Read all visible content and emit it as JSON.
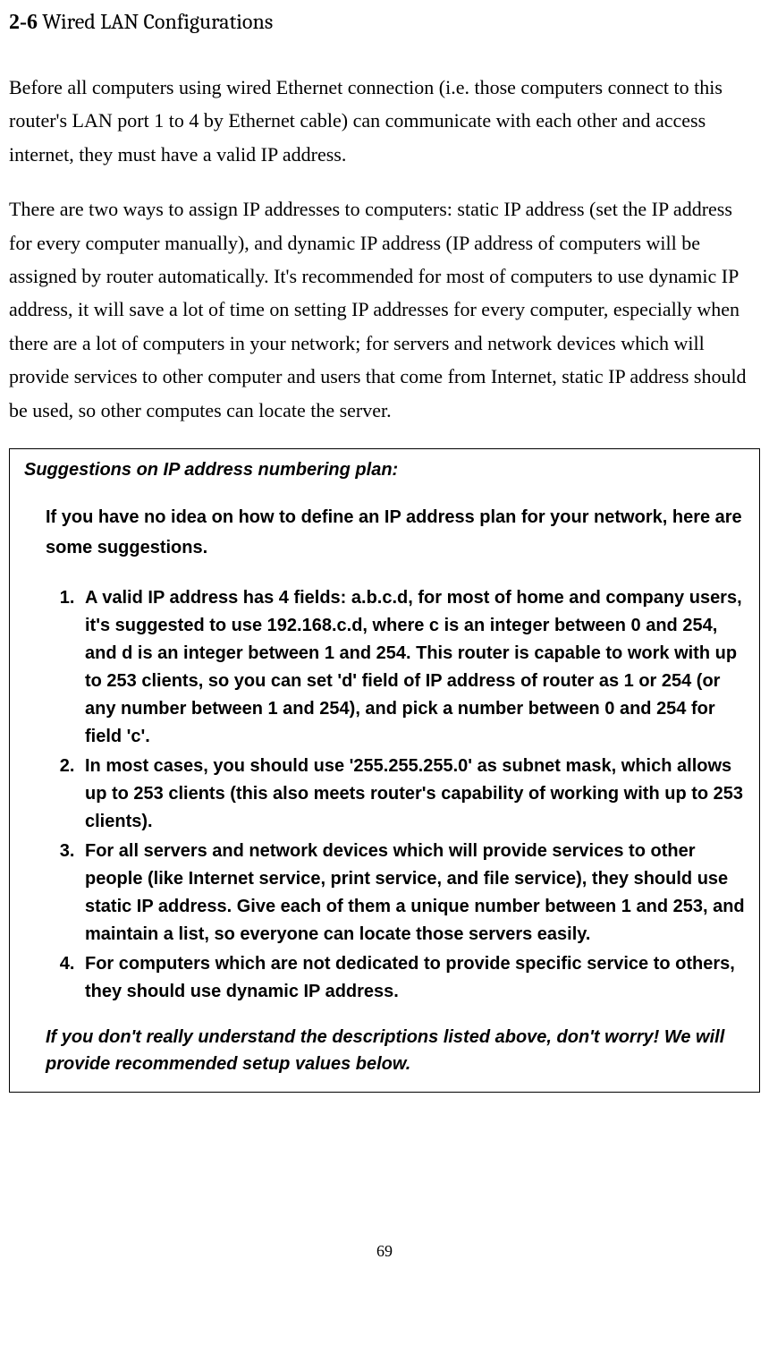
{
  "header": {
    "number": "2-6",
    "title": " Wired LAN Configurations"
  },
  "paragraphs": {
    "p1": "Before all computers using wired Ethernet connection (i.e. those computers connect to this router's LAN port 1 to 4 by Ethernet cable) can communicate with each other and access internet, they must have a valid IP address.",
    "p2": "There are two ways to assign IP addresses to computers: static IP address (set the IP address for every computer manually), and dynamic IP address (IP address of computers will be assigned by router automatically. It's recommended for most of computers to use dynamic IP address, it will save a lot of time on setting IP addresses for every computer, especially when there are a lot of computers in your network; for servers and network devices which will provide services to other computer and users that come from Internet, static IP address should be used, so other computes can locate the server."
  },
  "box": {
    "title": "Suggestions on IP address numbering plan:",
    "intro": "If you have no idea on how to define an IP address plan for your network, here are some suggestions.",
    "items": [
      "A valid IP address has 4 fields: a.b.c.d, for most of home and company users, it's suggested to use 192.168.c.d, where c is an integer between 0 and 254, and d is an integer between 1 and 254. This router is capable to work with up to 253 clients, so you can set 'd' field of IP address of router as 1 or 254 (or any number between 1 and 254), and pick a number between 0 and 254 for field 'c'.",
      "In most cases, you should use '255.255.255.0' as subnet mask, which allows up to 253 clients (this also meets router's capability of working with up to 253 clients).",
      "For all servers and network devices which will provide services to other people (like Internet service, print service, and file service), they should use static IP address. Give each of them a unique number between 1 and 253, and maintain a list, so everyone can locate those servers easily.",
      "For computers which are not dedicated to provide specific service to others, they should use dynamic IP address."
    ],
    "footer": "If you don't really understand the descriptions listed above, don't worry! We will provide recommended setup values below."
  },
  "pageNumber": "69"
}
